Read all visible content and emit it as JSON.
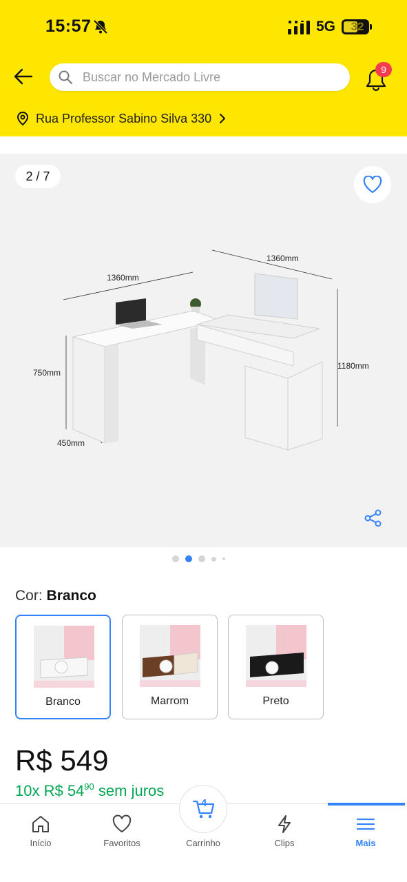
{
  "status_bar": {
    "time": "15:57",
    "network": "5G",
    "battery": "32"
  },
  "header": {
    "search_placeholder": "Buscar no Mercado Livre",
    "notification_count": "9",
    "address": "Rua Professor Sabino Silva 330"
  },
  "gallery": {
    "counter": "2 / 7",
    "dimensions": {
      "width_left": "1360mm",
      "width_right": "1360mm",
      "height_desk": "750mm",
      "height_total": "1180mm",
      "depth": "450mm"
    },
    "current_page": 2,
    "total_dots": 5
  },
  "variant": {
    "label": "Cor:",
    "selected": "Branco",
    "options": [
      {
        "name": "Branco",
        "color": "#f7f7f7"
      },
      {
        "name": "Marrom",
        "color": "#6b3e26"
      },
      {
        "name": "Preto",
        "color": "#1a1a1a"
      }
    ]
  },
  "pricing": {
    "price": "R$ 549",
    "installments_prefix": "10x R$ 54",
    "installments_cents": "90",
    "installments_suffix": "sem juros"
  },
  "bottom_nav": {
    "items": [
      {
        "label": "Início",
        "icon": "home-icon"
      },
      {
        "label": "Favoritos",
        "icon": "heart-icon"
      },
      {
        "label": "Carrinho",
        "icon": "cart-icon",
        "count": "4"
      },
      {
        "label": "Clips",
        "icon": "lightning-icon"
      },
      {
        "label": "Mais",
        "icon": "menu-icon",
        "active": true
      }
    ]
  },
  "colors": {
    "brand_yellow": "#ffe600",
    "accent_blue": "#3483fa",
    "price_green": "#00a650",
    "badge_red": "#f23d4f"
  }
}
